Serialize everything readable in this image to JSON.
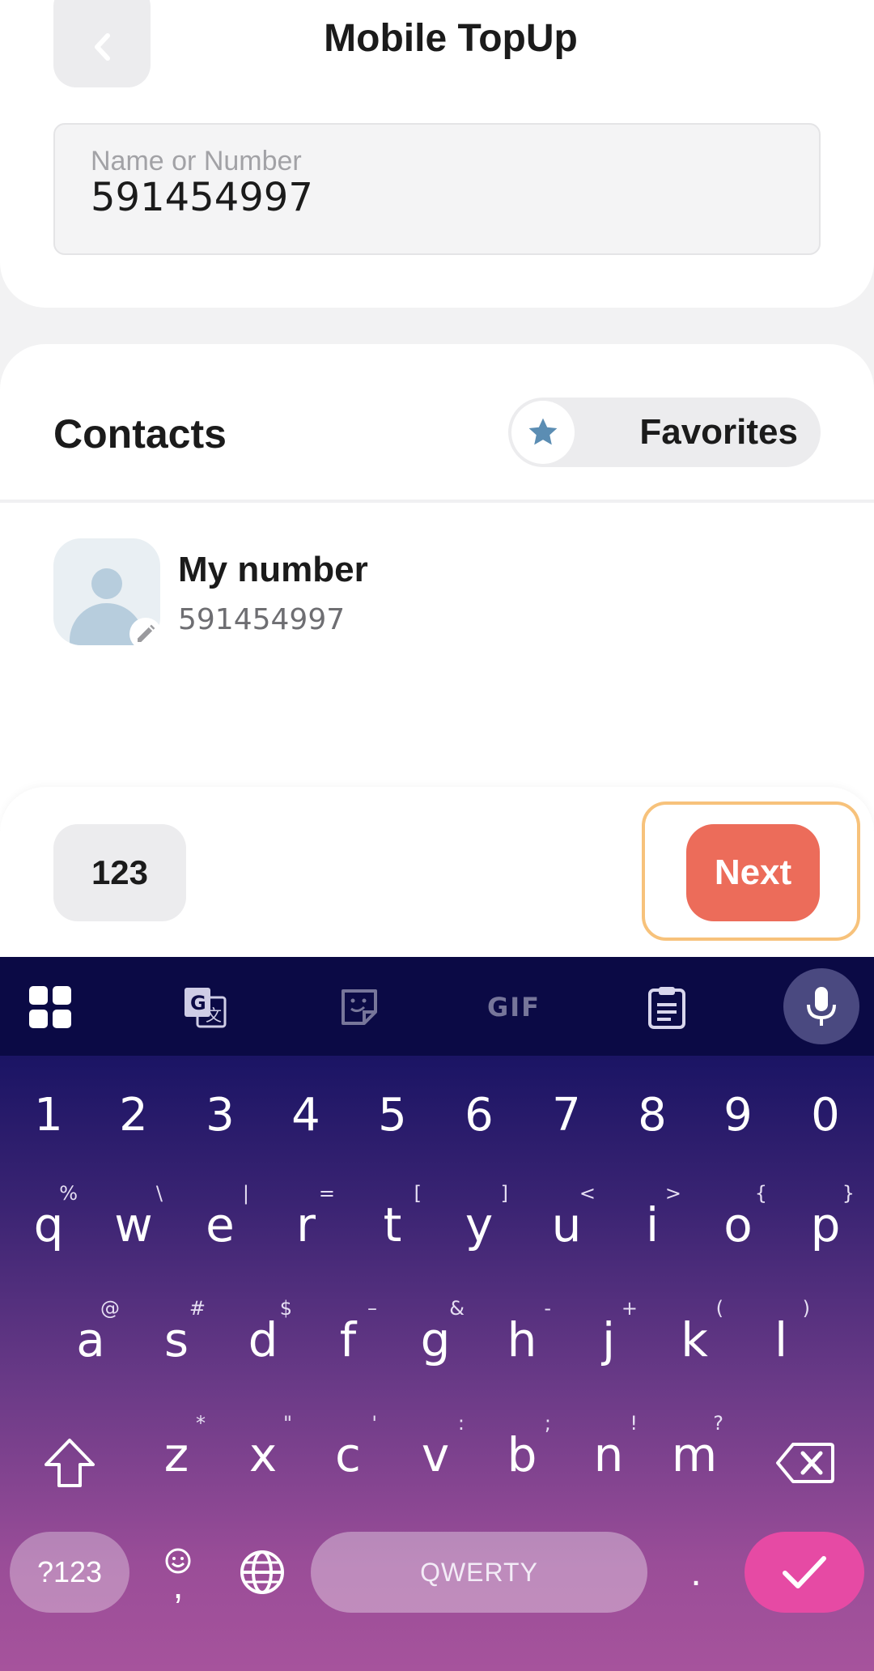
{
  "header": {
    "title": "Mobile TopUp",
    "back_icon": "chevron-left-icon"
  },
  "search": {
    "label": "Name or Number",
    "value": "591454997"
  },
  "contacts": {
    "title": "Contacts",
    "favorites_label": "Favorites",
    "favorites_icon": "star-icon",
    "items": [
      {
        "name": "My number",
        "number": "591454997",
        "avatar_icon": "person-icon",
        "edit_icon": "pencil-icon"
      }
    ]
  },
  "action_bar": {
    "numeric_label": "123",
    "next_label": "Next",
    "next_color": "#ec6c5a",
    "focus_color": "#f7c27b"
  },
  "keyboard": {
    "toolbar_icons": [
      "apps-grid-icon",
      "translate-icon",
      "sticker-icon",
      "gif-icon",
      "clipboard-icon",
      "mic-icon"
    ],
    "gif_label": "GIF",
    "number_row": [
      "1",
      "2",
      "3",
      "4",
      "5",
      "6",
      "7",
      "8",
      "9",
      "0"
    ],
    "row1": [
      {
        "key": "q",
        "hint": "%"
      },
      {
        "key": "w",
        "hint": "\\"
      },
      {
        "key": "e",
        "hint": "|"
      },
      {
        "key": "r",
        "hint": "="
      },
      {
        "key": "t",
        "hint": "["
      },
      {
        "key": "y",
        "hint": "]"
      },
      {
        "key": "u",
        "hint": "<"
      },
      {
        "key": "i",
        "hint": ">"
      },
      {
        "key": "o",
        "hint": "{"
      },
      {
        "key": "p",
        "hint": "}"
      }
    ],
    "row2": [
      {
        "key": "a",
        "hint": "@"
      },
      {
        "key": "s",
        "hint": "#"
      },
      {
        "key": "d",
        "hint": "$"
      },
      {
        "key": "f",
        "hint": "–"
      },
      {
        "key": "g",
        "hint": "&"
      },
      {
        "key": "h",
        "hint": "-"
      },
      {
        "key": "j",
        "hint": "+"
      },
      {
        "key": "k",
        "hint": "("
      },
      {
        "key": "l",
        "hint": ")"
      }
    ],
    "row3": [
      {
        "key": "z",
        "hint": "*"
      },
      {
        "key": "x",
        "hint": "\""
      },
      {
        "key": "c",
        "hint": "'"
      },
      {
        "key": "v",
        "hint": ":"
      },
      {
        "key": "b",
        "hint": ";"
      },
      {
        "key": "n",
        "hint": "!"
      },
      {
        "key": "m",
        "hint": "?"
      }
    ],
    "symbols_label": "?123",
    "comma_label": ",",
    "space_label": "QWERTY",
    "period_label": ".",
    "enter_color": "#e64aa4"
  }
}
